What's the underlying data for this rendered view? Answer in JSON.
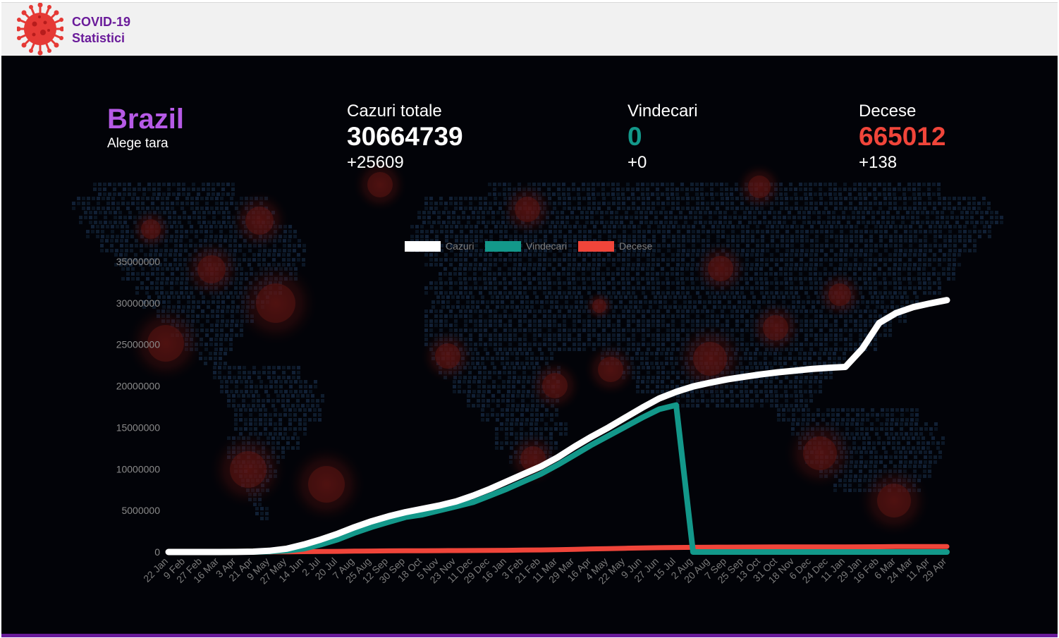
{
  "header": {
    "brand_line1": "COVID-19",
    "brand_line2": "Statistici",
    "logo_icon": "virus-icon",
    "brand_color": "#6a1b9a"
  },
  "country": {
    "name": "Brazil",
    "choose_label": "Alege tara"
  },
  "stats": {
    "cases": {
      "label": "Cazuri totale",
      "value": "30664739",
      "delta": "+25609",
      "color": "#ffffff"
    },
    "recovered": {
      "label": "Vindecari",
      "value": "0",
      "delta": "+0",
      "color": "#13988a"
    },
    "deaths": {
      "label": "Decese",
      "value": "665012",
      "delta": "+138",
      "color": "#f0453a"
    }
  },
  "chart_data": {
    "type": "line",
    "title": "",
    "xlabel": "",
    "ylabel": "",
    "ylim": [
      0,
      35000000
    ],
    "yticks": [
      "0",
      "5000000",
      "10000000",
      "15000000",
      "20000000",
      "25000000",
      "30000000",
      "35000000"
    ],
    "legend_position": "top-center",
    "x": [
      "22 Jan",
      "9 Feb",
      "27 Feb",
      "16 Mar",
      "3 Apr",
      "21 Apr",
      "9 May",
      "27 May",
      "14 Jun",
      "2 Jul",
      "20 Jul",
      "7 Aug",
      "25 Aug",
      "12 Sep",
      "30 Sep",
      "18 Oct",
      "5 Nov",
      "23 Nov",
      "11 Dec",
      "29 Dec",
      "16 Jan",
      "3 Feb",
      "21 Feb",
      "11 Mar",
      "29 Mar",
      "16 Apr",
      "4 May",
      "22 May",
      "9 Jun",
      "27 Jun",
      "15 Jul",
      "2 Aug",
      "20 Aug",
      "7 Sep",
      "25 Sep",
      "13 Oct",
      "31 Oct",
      "18 Nov",
      "6 Dec",
      "24 Dec",
      "11 Jan",
      "29 Jan",
      "16 Feb",
      "6 Mar",
      "24 Mar",
      "11 Apr",
      "29 Apr"
    ],
    "series": [
      {
        "name": "Cazuri",
        "color": "#ffffff",
        "values": [
          0,
          0,
          0,
          0,
          8000,
          40000,
          150000,
          400000,
          900000,
          1500000,
          2200000,
          3000000,
          3700000,
          4300000,
          4800000,
          5200000,
          5600000,
          6100000,
          6800000,
          7600000,
          8500000,
          9400000,
          10300000,
          11400000,
          12700000,
          13900000,
          15000000,
          16200000,
          17400000,
          18500000,
          19300000,
          19950000,
          20400000,
          20800000,
          21100000,
          21400000,
          21650000,
          21850000,
          22050000,
          22200000,
          22300000,
          24500000,
          27600000,
          28800000,
          29500000,
          29950000,
          30350000
        ]
      },
      {
        "name": "Vindecari",
        "color": "#13988a",
        "values": [
          0,
          0,
          0,
          0,
          0,
          10000,
          60000,
          160000,
          400000,
          900000,
          1500000,
          2300000,
          3000000,
          3600000,
          4200000,
          4500000,
          5000000,
          5500000,
          6000000,
          6800000,
          7600000,
          8500000,
          9400000,
          10500000,
          11700000,
          12900000,
          14000000,
          15100000,
          16200000,
          17200000,
          17700000,
          0,
          0,
          0,
          0,
          0,
          0,
          0,
          0,
          0,
          0,
          0,
          0,
          0,
          0,
          0,
          0
        ]
      },
      {
        "name": "Decese",
        "color": "#f0453a",
        "values": [
          0,
          0,
          0,
          0,
          500,
          3000,
          10000,
          25000,
          42000,
          60000,
          80000,
          100000,
          120000,
          135000,
          145000,
          155000,
          162000,
          170000,
          180000,
          193000,
          208000,
          228000,
          250000,
          280000,
          320000,
          370000,
          410000,
          450000,
          490000,
          520000,
          545000,
          560000,
          575000,
          585000,
          595000,
          605000,
          610000,
          615000,
          618000,
          620000,
          623000,
          630000,
          640000,
          652000,
          658000,
          662000,
          665000
        ]
      }
    ]
  }
}
